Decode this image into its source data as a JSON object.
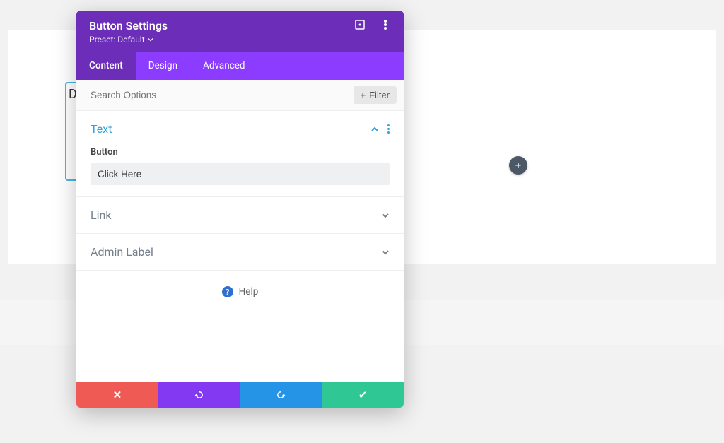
{
  "canvas": {
    "add_tooltip": "Add"
  },
  "modal": {
    "title": "Button Settings",
    "preset_label": "Preset: Default",
    "tabs": {
      "content": "Content",
      "design": "Design",
      "advanced": "Advanced"
    },
    "search_placeholder": "Search Options",
    "filter_label": "Filter",
    "sections": {
      "text": {
        "title": "Text",
        "field_label": "Button",
        "field_value": "Click Here"
      },
      "link": {
        "title": "Link"
      },
      "admin_label": {
        "title": "Admin Label"
      }
    },
    "help_label": "Help"
  }
}
